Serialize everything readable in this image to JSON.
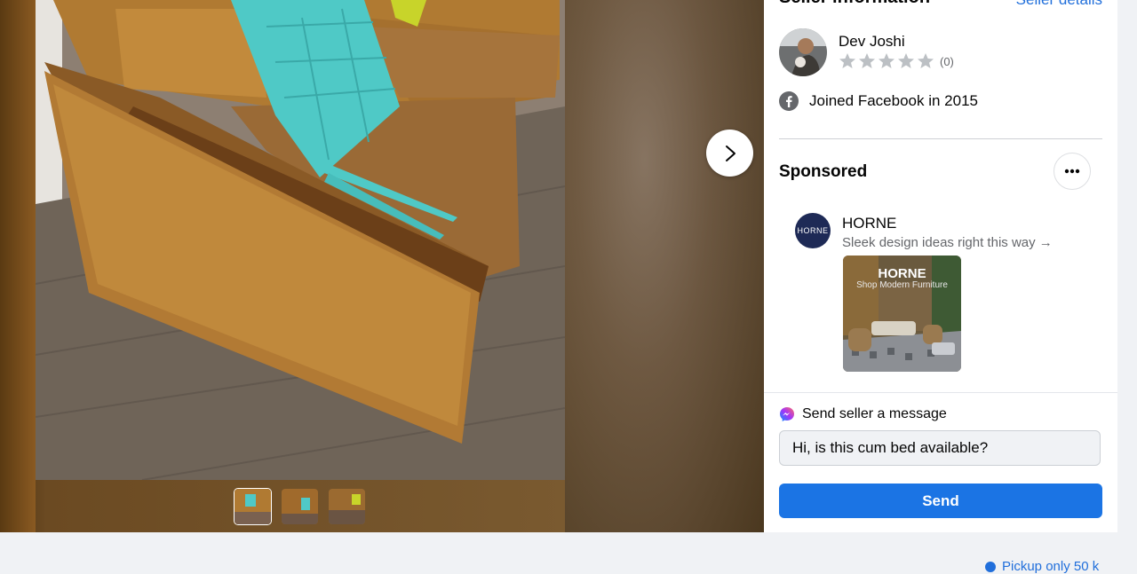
{
  "seller_section": {
    "title": "Seller information",
    "details_link": "Seller details",
    "name": "Dev Joshi",
    "rating_count": "(0)",
    "joined": "Joined Facebook in 2015"
  },
  "sponsored": {
    "title": "Sponsored",
    "advertiser": "HORNE",
    "logo_text": "HORNE",
    "tagline": "Sleek design ideas right this way →",
    "image_brand": "HORNE",
    "image_sub": "Shop Modern Furniture"
  },
  "message": {
    "header": "Send seller a message",
    "input_value": "Hi, is this cum bed available?",
    "send_label": "Send"
  },
  "footer": {
    "link": "Pickup only 50 k"
  },
  "colors": {
    "accent": "#1b74e4",
    "link": "#216fdb",
    "star": "#bcc0c4"
  }
}
